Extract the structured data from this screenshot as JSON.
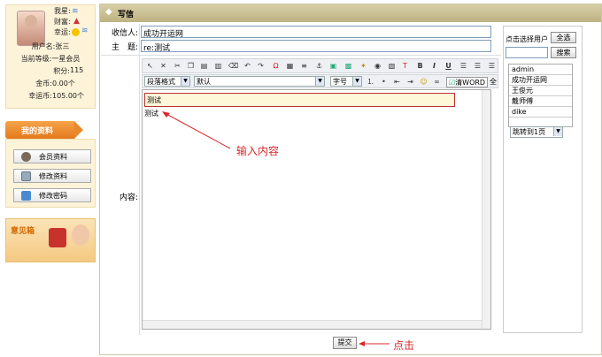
{
  "profile": {
    "rank_label": "我星:",
    "wealth_label": "财富:",
    "luck_label": "幸运:",
    "username_label": "用户名:",
    "username": "张三",
    "level_label": "当前等级:",
    "level": "一星会员",
    "points_label": "积分:",
    "points": "115",
    "gold_label": "金币:",
    "gold": "0.00个",
    "coin_label": "幸运币:",
    "coin": "105.00个"
  },
  "sidebar": {
    "section_title": "我的资料",
    "items": [
      {
        "label": "会员资料"
      },
      {
        "label": "修改资料"
      },
      {
        "label": "修改密码"
      }
    ],
    "feedback_label": "意见箱"
  },
  "window": {
    "title": "写信"
  },
  "form": {
    "recipient_label": "收信人:",
    "recipient_value": "成功开运网",
    "subject_label": "主　题:",
    "subject_value": "re:测试",
    "content_label": "内容:",
    "submit_label": "提交"
  },
  "editor": {
    "paragraph_format": "段落格式",
    "font": "默认",
    "font_size": "字号",
    "clear_word": "清WORD",
    "full_label": "全",
    "quoted_text": "测试",
    "typed_text": "测试",
    "toolbar_icons": [
      "select-icon",
      "delete-icon",
      "cut-icon",
      "copy-icon",
      "paste-icon",
      "paste-text-icon",
      "eraser-icon",
      "undo-icon",
      "redo-icon",
      "special-char-icon",
      "table-icon",
      "hr-icon",
      "anchor-icon",
      "image-icon",
      "image-link-icon",
      "flash-icon",
      "media-icon",
      "find-icon",
      "text-color-icon",
      "bold-icon",
      "italic-icon",
      "underline-icon",
      "align-left-icon",
      "align-center-icon",
      "align-right-icon"
    ],
    "toolbar2_icons": [
      "ordered-list-icon",
      "unordered-list-icon",
      "outdent-icon",
      "indent-icon",
      "emoticon-icon",
      "binoculars-icon"
    ]
  },
  "user_picker": {
    "label": "点击选择用户",
    "select_all": "全选",
    "search": "搜索",
    "users": [
      "admin",
      "成功开运网",
      "王俊元",
      "戴师傅",
      "dike"
    ],
    "jump_value": "跳转到1页"
  },
  "annotations": {
    "input_hint": "输入内容",
    "click_hint": "点击"
  },
  "colors": {
    "annotation_red": "#d8282b",
    "accent_orange": "#e88a2a",
    "title_bar": "#c9bf92"
  }
}
